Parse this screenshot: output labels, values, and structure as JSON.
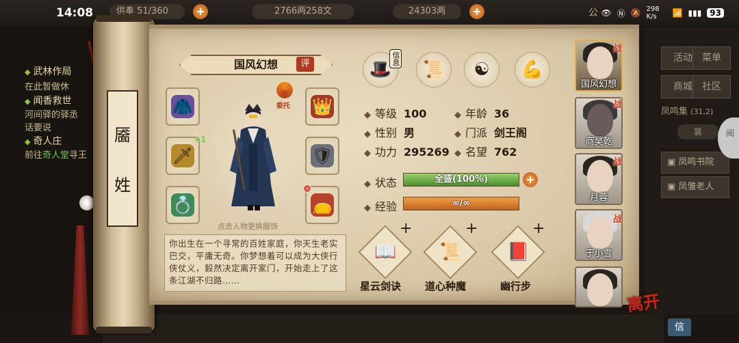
{
  "status_bar": {
    "time": "14:08",
    "net_speed": "298 K/s",
    "battery": "93"
  },
  "game_bg": {
    "res_stamina": "供奉 51/360",
    "res_silver": "2766两258文",
    "res_gold": "24303两",
    "clan_abbrev": "公",
    "quests": [
      {
        "title": "武林作局",
        "desc": "在此暂做休"
      },
      {
        "title": "闻香救世",
        "desc": "河间驿的驿丞"
      },
      {
        "title": "",
        "desc": "话要说"
      },
      {
        "title": "奇人庄",
        "desc_prefix": "前往",
        "desc_highlight": "奇人堂",
        "desc_suffix": "寻王"
      }
    ],
    "right_menu": [
      "活动",
      "菜单",
      "商城",
      "社区"
    ],
    "right_panel_title": "凤鸣集",
    "right_panel_coord": "(31,2)",
    "right_panel_sub": "装",
    "right_list": [
      "凤鸣书院",
      "凤雏老人"
    ],
    "side_pill": "阅",
    "bottom_letter": "信"
  },
  "scroll": {
    "surname_chars": [
      "靥",
      "姓"
    ],
    "title": "国风幻想",
    "eval_badge": "评",
    "entrust_label": "委托",
    "enhance_plus": "+1",
    "change_outfit_hint": "点击人物更换服饰",
    "bio": "你出生在一个寻常的百姓家庭，你天生老实巴交，平庸无奇。你梦想着可以成为大侠行侠仗义，毅然决定离开家门，开始走上了这条江湖不归路……",
    "top_icons": [
      {
        "name": "hat-icon",
        "glyph": "🎩",
        "label": "信息"
      },
      {
        "name": "scroll-map-icon",
        "glyph": "📜"
      },
      {
        "name": "bagua-icon",
        "glyph": "☯"
      },
      {
        "name": "body-icon",
        "glyph": "💪"
      }
    ],
    "stats": {
      "level_label": "等级",
      "level": "100",
      "age_label": "年龄",
      "age": "36",
      "gender_label": "性别",
      "gender": "男",
      "sect_label": "门派",
      "sect": "剑王阁",
      "power_label": "功力",
      "power": "295269",
      "fame_label": "名望",
      "fame": "762"
    },
    "state_label": "状态",
    "state_text": "全盛(100%)",
    "state_percent": 100,
    "exp_label": "经验",
    "exp_text": "∞/∞",
    "skills": [
      {
        "name": "星云剑诀",
        "glyph": "📖"
      },
      {
        "name": "道心种魔",
        "glyph": "📜"
      },
      {
        "name": "幽行步",
        "glyph": "📕"
      }
    ],
    "equipment_left": [
      {
        "name": "armor-bundle-icon",
        "glyph": "🧥",
        "color": "#6b4f9a"
      },
      {
        "name": "sword-icon",
        "glyph": "🗡",
        "color": "#b58a2a"
      },
      {
        "name": "ring-icon",
        "glyph": "💍",
        "color": "#3d8a5a"
      }
    ],
    "equipment_right": [
      {
        "name": "headgear-icon",
        "glyph": "👑",
        "color": "#a53a2a"
      },
      {
        "name": "chestplate-icon",
        "glyph": "🛡",
        "color": "#6a6f7a"
      },
      {
        "name": "pouch-icon",
        "glyph": "👝",
        "color": "#b5442a"
      }
    ]
  },
  "roster": {
    "war_tag": "战",
    "heroes": [
      {
        "name": "国风幻想",
        "active": true,
        "war": true
      },
      {
        "name": "商昊乾",
        "active": false,
        "war": true
      },
      {
        "name": "月蓉",
        "active": false,
        "war": true
      },
      {
        "name": "于小雪",
        "active": false,
        "war": true
      },
      {
        "name": "",
        "active": false,
        "war": false
      }
    ],
    "leave": "离开"
  }
}
